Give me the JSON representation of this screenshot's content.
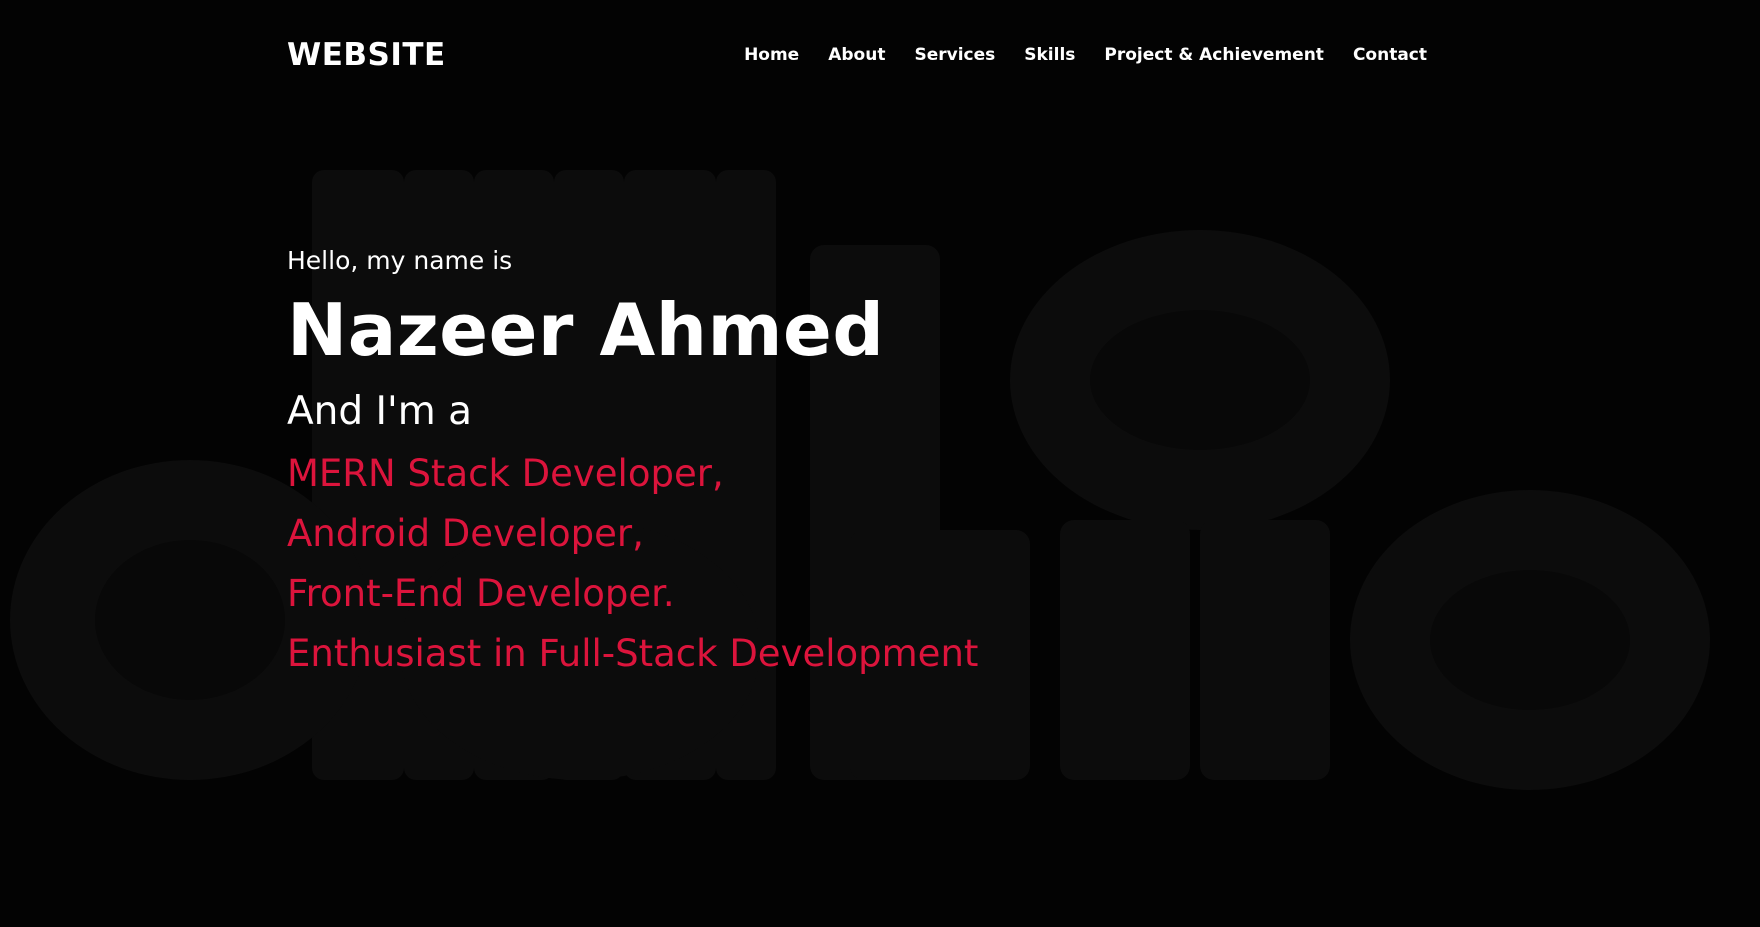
{
  "header": {
    "logo": "WEBSITE",
    "nav": [
      {
        "label": "Home"
      },
      {
        "label": "About"
      },
      {
        "label": "Services"
      },
      {
        "label": "Skills"
      },
      {
        "label": "Project & Achievement"
      },
      {
        "label": "Contact"
      }
    ]
  },
  "hero": {
    "greeting": "Hello, my name is",
    "name": "Nazeer Ahmed",
    "intro": "And I'm a",
    "roles": [
      "MERN Stack Developer,",
      "Android Developer,",
      "Front-End Developer.",
      "Enthusiast in Full-Stack Development"
    ]
  },
  "colors": {
    "background": "#030303",
    "text": "#ffffff",
    "accent": "#dc143c",
    "background_art": "#0d0d0d"
  }
}
